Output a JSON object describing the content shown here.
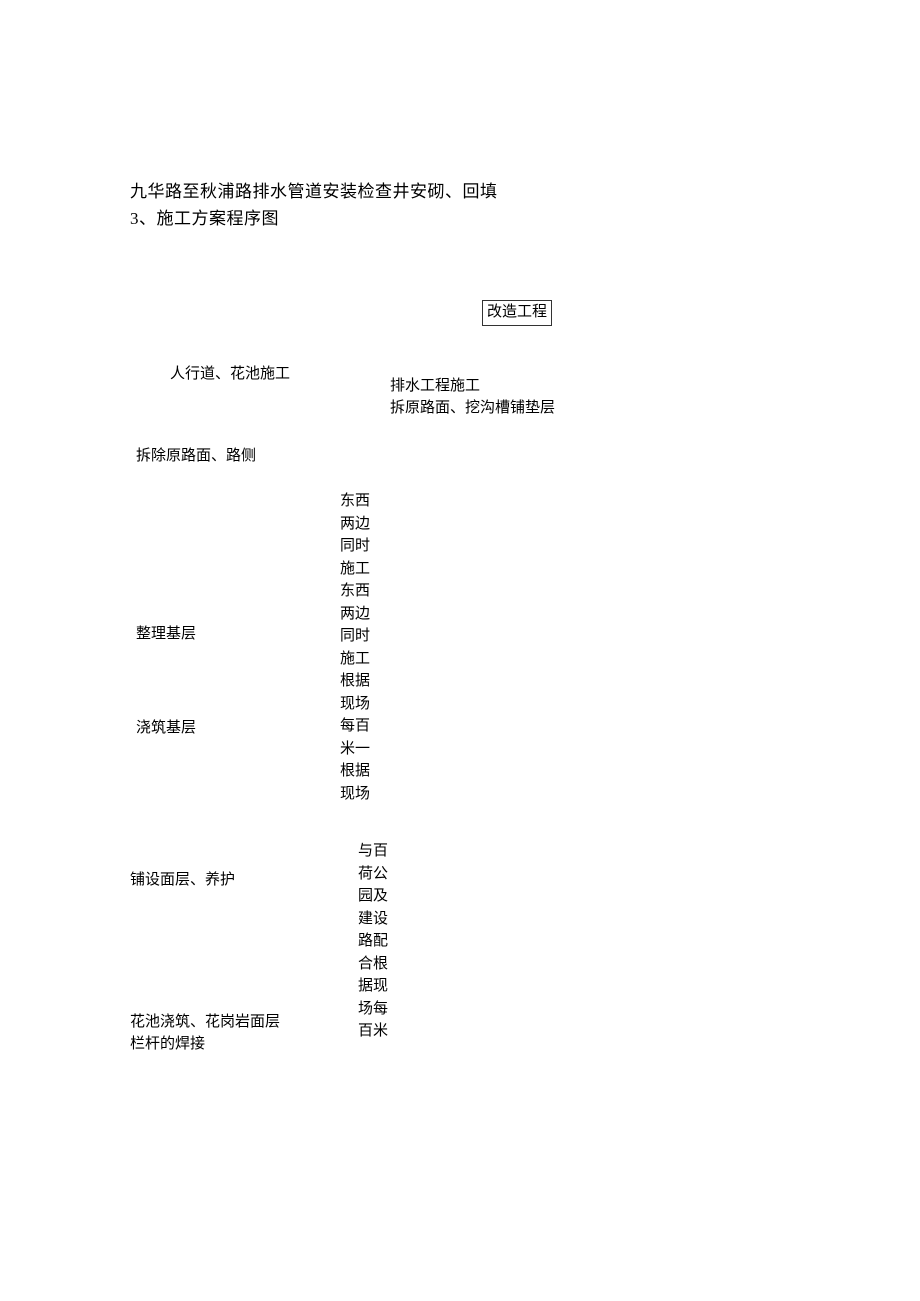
{
  "header": {
    "line1": "九华路至秋浦路排水管道安装检查井安砌、回填",
    "line2": "3、施工方案程序图"
  },
  "box_top": "改造工程",
  "left": {
    "item1": "人行道、花池施工",
    "item2": "拆除原路面、路侧",
    "item3": "整理基层",
    "item4": "浇筑基层",
    "item5": "铺设面层、养护",
    "item6a": "花池浇筑、花岗岩面层",
    "item6b": "栏杆的焊接"
  },
  "right": {
    "line1": "排水工程施工",
    "line2": "拆原路面、挖沟槽铺垫层"
  },
  "mid_vertical": "东西两边同时施工东西两边同时施工根据现场每百米一根据现场",
  "bottom_vertical": "与百荷公园及建设路配合根据现场每百米"
}
